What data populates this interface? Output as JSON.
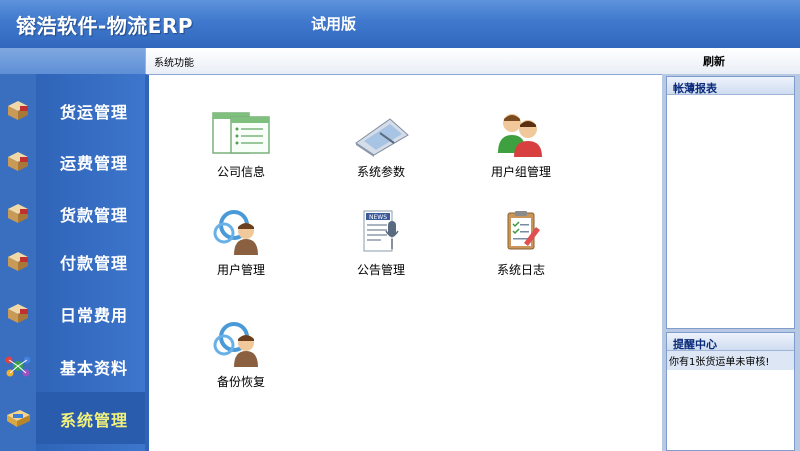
{
  "header": {
    "title": "镕浩软件-物流ERP",
    "edition": "试用版"
  },
  "content": {
    "title": "系统功能",
    "refresh_label": "刷新"
  },
  "sidebar": {
    "items": [
      {
        "label": "货运管理",
        "icon": "box-icon"
      },
      {
        "label": "运费管理",
        "icon": "box-icon"
      },
      {
        "label": "货款管理",
        "icon": "box-icon"
      },
      {
        "label": "付款管理",
        "icon": "box-icon"
      },
      {
        "label": "日常费用",
        "icon": "box-icon"
      },
      {
        "label": "基本资料",
        "icon": "network-icon"
      },
      {
        "label": "系统管理",
        "icon": "monitor-icon",
        "active": true
      }
    ]
  },
  "functions": [
    {
      "label": "公司信息",
      "icon": "company-info-icon"
    },
    {
      "label": "系统参数",
      "icon": "system-params-icon"
    },
    {
      "label": "用户组管理",
      "icon": "user-group-icon"
    },
    {
      "label": "用户管理",
      "icon": "user-icon"
    },
    {
      "label": "公告管理",
      "icon": "news-mic-icon"
    },
    {
      "label": "系统日志",
      "icon": "log-clipboard-icon"
    },
    {
      "label": "备份恢复",
      "icon": "backup-user-icon"
    }
  ],
  "right_panel": {
    "reports_title": "帐薄报表",
    "reminder_title": "提醒中心",
    "reminder_text": "你有1张货运单未审核!"
  }
}
